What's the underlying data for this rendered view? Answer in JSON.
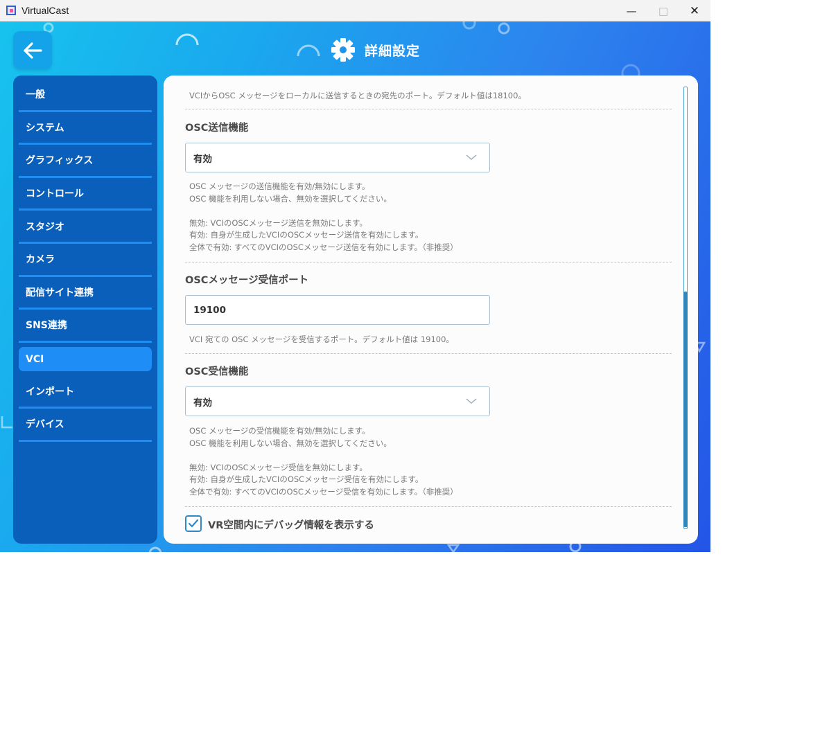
{
  "window": {
    "title": "VirtualCast",
    "controls": {
      "minimize": "—",
      "maximize": "□",
      "close": "✕"
    }
  },
  "header": {
    "title": "詳細設定",
    "icon": "gear-icon",
    "back_icon": "arrow-left-icon"
  },
  "sidebar": {
    "items": [
      {
        "label": "一般",
        "active": false
      },
      {
        "label": "システム",
        "active": false
      },
      {
        "label": "グラフィックス",
        "active": false
      },
      {
        "label": "コントロール",
        "active": false
      },
      {
        "label": "スタジオ",
        "active": false
      },
      {
        "label": "カメラ",
        "active": false
      },
      {
        "label": "配信サイト連携",
        "active": false
      },
      {
        "label": "SNS連携",
        "active": false
      },
      {
        "label": "VCI",
        "active": true
      },
      {
        "label": "インポート",
        "active": false
      },
      {
        "label": "デバイス",
        "active": false
      }
    ]
  },
  "content": {
    "top_desc": "VCIからOSC メッセージをローカルに送信するときの宛先のポート。デフォルト値は18100。",
    "osc_send": {
      "label": "OSC送信機能",
      "value": "有効",
      "desc": "OSC メッセージの送信機能を有効/無効にします。\nOSC 機能を利用しない場合、無効を選択してください。\n\n無効: VCIのOSCメッセージ送信を無効にします。\n有効: 自身が生成したVCIのOSCメッセージ送信を有効にします。\n全体で有効: すべてのVCIのOSCメッセージ送信を有効にします。（非推奨）"
    },
    "osc_recv_port": {
      "label": "OSCメッセージ受信ポート",
      "value": "19100",
      "desc": "VCI 宛ての OSC メッセージを受信するポート。デフォルト値は 19100。"
    },
    "osc_recv": {
      "label": "OSC受信機能",
      "value": "有効",
      "desc": "OSC メッセージの受信機能を有効/無効にします。\nOSC 機能を利用しない場合、無効を選択してください。\n\n無効: VCIのOSCメッセージ受信を無効にします。\n有効: 自身が生成したVCIのOSCメッセージ受信を有効にします。\n全体で有効: すべてのVCIのOSCメッセージ受信を有効にします。（非推奨）"
    },
    "debug_checkbox": {
      "label": "VR空間内にデバッグ情報を表示する",
      "checked": true
    }
  },
  "colors": {
    "sidebar_bg": "#0a5fba",
    "sidebar_active": "#1e8ef6",
    "accent": "#2f89c9",
    "panel_bg": "#fcfcfc"
  }
}
